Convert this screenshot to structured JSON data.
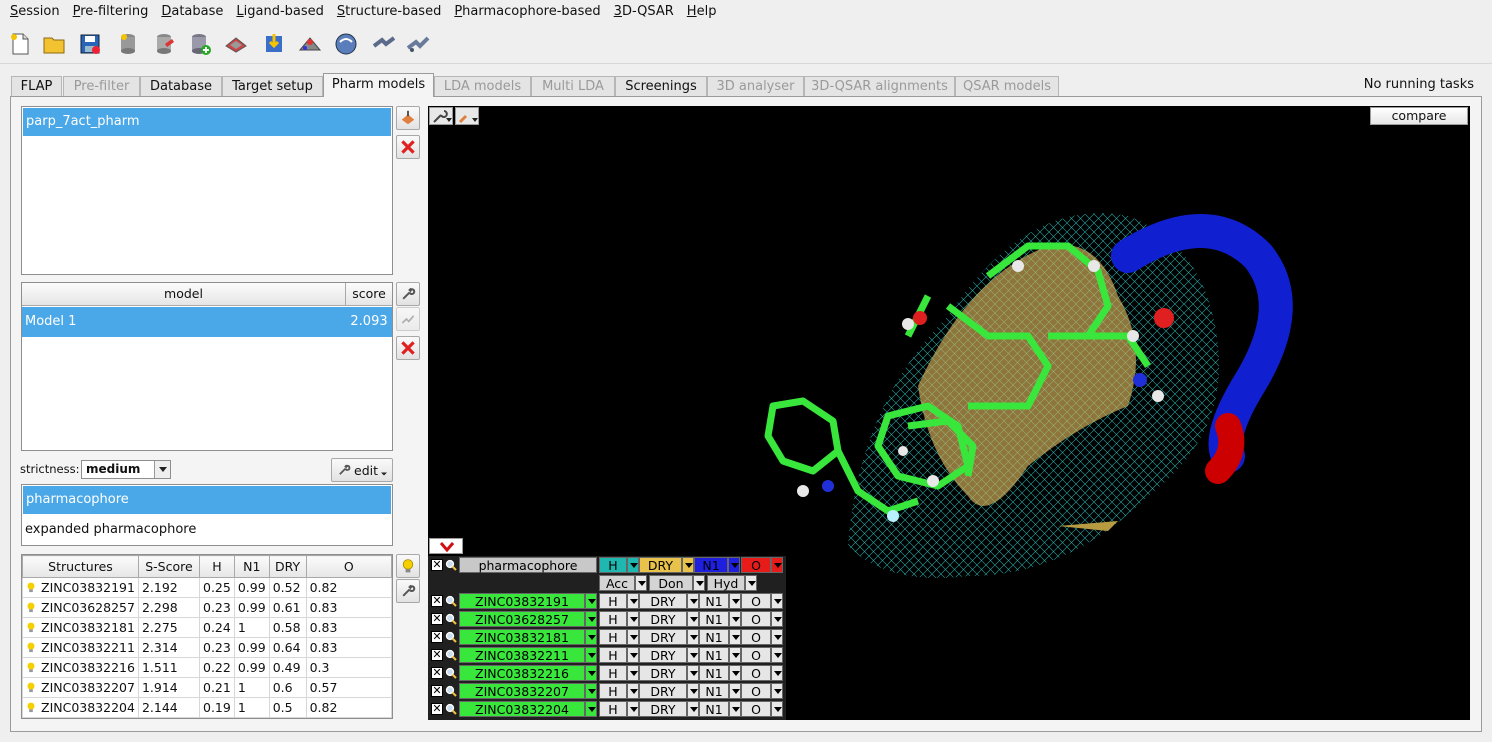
{
  "menu": [
    "Session",
    "Pre-filtering",
    "Database",
    "Ligand-based",
    "Structure-based",
    "Pharmacophore-based",
    "3D-QSAR",
    "Help"
  ],
  "menu_underline": [
    "S",
    "P",
    "D",
    "L",
    "S",
    "P",
    "3",
    "H"
  ],
  "menu_rest": [
    "ession",
    "re-filtering",
    "atabase",
    "igand-based",
    "tructure-based",
    "harmacophore-based",
    "D-QSAR",
    "elp"
  ],
  "tabs": [
    {
      "label": "FLAP",
      "state": "normal"
    },
    {
      "label": "Pre-filter",
      "state": "disabled"
    },
    {
      "label": "Database",
      "state": "normal"
    },
    {
      "label": "Target setup",
      "state": "normal"
    },
    {
      "label": "Pharm models",
      "state": "active"
    },
    {
      "label": "LDA models",
      "state": "disabled"
    },
    {
      "label": "Multi LDA",
      "state": "disabled"
    },
    {
      "label": "Screenings",
      "state": "normal"
    },
    {
      "label": "3D analyser",
      "state": "disabled"
    },
    {
      "label": "3D-QSAR alignments",
      "state": "disabled"
    },
    {
      "label": "QSAR models",
      "state": "disabled"
    }
  ],
  "status": {
    "running": "No running tasks"
  },
  "pharm_list": {
    "selected": "parp_7act_pharm"
  },
  "model_table": {
    "headers": [
      "model",
      "score"
    ],
    "rows": [
      {
        "model": "Model 1",
        "score": "2.093"
      }
    ]
  },
  "strictness": {
    "label": "strictness:",
    "value": "medium",
    "edit_label": "edit"
  },
  "mode_list": {
    "items": [
      "pharmacophore",
      "expanded pharmacophore"
    ]
  },
  "structures": {
    "headers": [
      "Structures",
      "S-Score",
      "H",
      "N1",
      "DRY",
      "O"
    ],
    "rows": [
      [
        "ZINC03832191",
        "2.192",
        "0.25",
        "0.99",
        "0.52",
        "0.82"
      ],
      [
        "ZINC03628257",
        "2.298",
        "0.23",
        "0.99",
        "0.61",
        "0.83"
      ],
      [
        "ZINC03832181",
        "2.275",
        "0.24",
        "1",
        "0.58",
        "0.83"
      ],
      [
        "ZINC03832211",
        "2.314",
        "0.23",
        "0.99",
        "0.64",
        "0.83"
      ],
      [
        "ZINC03832216",
        "1.511",
        "0.22",
        "0.99",
        "0.49",
        "0.3"
      ],
      [
        "ZINC03832207",
        "1.914",
        "0.21",
        "1",
        "0.6",
        "0.57"
      ],
      [
        "ZINC03832204",
        "2.144",
        "0.19",
        "1",
        "0.5",
        "0.82"
      ]
    ]
  },
  "viewer": {
    "compare_label": "compare",
    "ph_header": {
      "name": "pharmacophore",
      "cols": [
        "H",
        "DRY",
        "N1",
        "O"
      ],
      "col_colors": [
        "#1fb8b0",
        "#e8c24a",
        "#1f1fe0",
        "#e81b1b"
      ]
    },
    "ph_sub": [
      "Acc",
      "Don",
      "Hyd"
    ],
    "ph_rows": [
      {
        "name": "ZINC03832191",
        "vals": [
          "H",
          "DRY",
          "N1",
          "O"
        ]
      },
      {
        "name": "ZINC03628257",
        "vals": [
          "H",
          "DRY",
          "N1",
          "O"
        ]
      },
      {
        "name": "ZINC03832181",
        "vals": [
          "H",
          "DRY",
          "N1",
          "O"
        ]
      },
      {
        "name": "ZINC03832211",
        "vals": [
          "H",
          "DRY",
          "N1",
          "O"
        ]
      },
      {
        "name": "ZINC03832216",
        "vals": [
          "H",
          "DRY",
          "N1",
          "O"
        ]
      },
      {
        "name": "ZINC03832207",
        "vals": [
          "H",
          "DRY",
          "N1",
          "O"
        ]
      },
      {
        "name": "ZINC03832204",
        "vals": [
          "H",
          "DRY",
          "N1",
          "O"
        ]
      }
    ]
  },
  "colors": {
    "selection": "#4aa8e8",
    "ligand_green": "#39e63b",
    "ribbon_blue": "#1020d0",
    "ribbon_red": "#cc0000",
    "mesh": "#29c6c0",
    "surface": "#d8b45a"
  }
}
